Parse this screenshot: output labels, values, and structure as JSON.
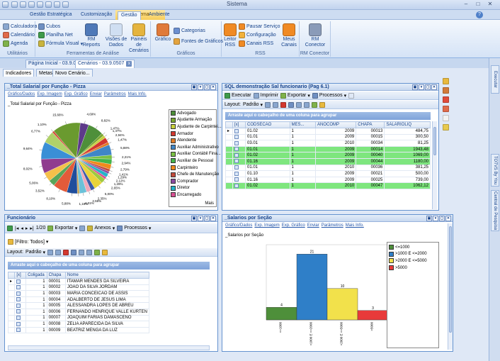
{
  "window": {
    "title": "Sistema"
  },
  "menu": {
    "tabs": [
      "Gestão Estratégica",
      "Customização",
      "Gestão",
      "Ambiente"
    ],
    "active": "Gestão"
  },
  "ribbon": {
    "utilitarios": {
      "label": "Utilitários",
      "items": [
        "Calculadora",
        "Calendário",
        "Agenda"
      ]
    },
    "ferramentas": {
      "label": "Ferramentas de Análise",
      "items": [
        "Cubos",
        "Planilha Net",
        "Fórmula Visual"
      ],
      "big": [
        "RM Reports",
        "Visões de Dados",
        "Painéis de Cenários"
      ]
    },
    "graficos": {
      "label": "Gráficos",
      "big": "Gráfico",
      "items": [
        "Categorias",
        "Fontes de Gráficos"
      ]
    },
    "rss": {
      "label": "RSS",
      "big1": "Leitor RSS",
      "items": [
        "Pausar Serviço",
        "Configuração",
        "Canais RSS"
      ],
      "big2": "Meus Canais"
    },
    "rmconector": {
      "label": "RM Conector",
      "big": "RM Conector"
    }
  },
  "doc_tabs": [
    "Página Inicial - 03.9.0507",
    "Cenários - 03.9.0507"
  ],
  "sub_tabs": [
    "Indicadores",
    "Metas",
    "Novo Cenário..."
  ],
  "right_tabs": [
    "Executar",
    "TOTVS By You",
    "Central de Pesquisa"
  ],
  "pie_panel": {
    "title": "_Total Salarial por Função - Pizza",
    "links": [
      "Gráfico/Dados",
      "Exp. Imagem",
      "Exp. Gráfico",
      "Enviar",
      "Parâmetros",
      "Mais Info."
    ],
    "chart_title": "_Total Salarial por Função - Pizza",
    "legend": [
      "Advogado",
      "Ajudante Armação",
      "Ajudante de Carpintei...",
      "Armador",
      "Atendente",
      "Auxiliar Administrativo",
      "Auxiliar Contábil Fina...",
      "Auxiliar de Pessoal",
      "Carpinteiro",
      "Chefe de Manutenção",
      "Comprador",
      "Diretor",
      "Encarregado"
    ],
    "legend_more": "Mais"
  },
  "sql_panel": {
    "title": "SQL demonstração Sal funcionario (Pag 6.1)",
    "toolbar": [
      "Executar",
      "Imprimir",
      "Exportar",
      "Processos"
    ],
    "layout_label": "Layout:",
    "layout_value": "Padrão",
    "group_hint": "Arraste aqui o cabeçalho de uma coluna para agrupar",
    "columns": [
      "[x]",
      "CODSECAO",
      "MES...",
      "ANOCOMP",
      "CHAPA",
      "SALARIOLIQ"
    ],
    "rows": [
      {
        "codsecao": "01.02",
        "mes": "1",
        "ano": "2009",
        "chapa": "00013",
        "sal": "484,75",
        "hl": false
      },
      {
        "codsecao": "01.01",
        "mes": "1",
        "ano": "2009",
        "chapa": "00015",
        "sal": "300,50",
        "hl": false
      },
      {
        "codsecao": "03.01",
        "mes": "1",
        "ano": "2010",
        "chapa": "00034",
        "sal": "81,25",
        "hl": false
      },
      {
        "codsecao": "01.01",
        "mes": "1",
        "ano": "2009",
        "chapa": "00014",
        "sal": "1943,48",
        "hl": true
      },
      {
        "codsecao": "01.02",
        "mes": "1",
        "ano": "2009",
        "chapa": "00040",
        "sal": "1069,00",
        "hl": true
      },
      {
        "codsecao": "01.16",
        "mes": "1",
        "ano": "2009",
        "chapa": "00044",
        "sal": "1180,00",
        "hl": true
      },
      {
        "codsecao": "01.01",
        "mes": "1",
        "ano": "2010",
        "chapa": "00036",
        "sal": "381,25",
        "hl": false
      },
      {
        "codsecao": "01.10",
        "mes": "1",
        "ano": "2009",
        "chapa": "00021",
        "sal": "500,00",
        "hl": false
      },
      {
        "codsecao": "01.16",
        "mes": "1",
        "ano": "2009",
        "chapa": "00025",
        "sal": "739,00",
        "hl": false
      },
      {
        "codsecao": "01.02",
        "mes": "1",
        "ano": "2010",
        "chapa": "00047",
        "sal": "1062,12",
        "hl": true
      }
    ]
  },
  "func_panel": {
    "title": "Funcionário",
    "pager": "1/20",
    "toolbar": [
      "Exportar",
      "Anexos",
      "Processos"
    ],
    "filter": "[Filtro: Todos]",
    "layout_label": "Layout:",
    "layout_value": "Padrão",
    "group_hint": "Arraste aqui o cabeçalho de uma coluna para agrupar",
    "columns": [
      "[x]",
      "Coligada",
      "Chapa",
      "Nome"
    ],
    "rows": [
      {
        "col": "1",
        "chapa": "00001",
        "nome": "ITAMAR MENDES DA SILVEIRA"
      },
      {
        "col": "1",
        "chapa": "00002",
        "nome": "JOAO DA SILVA JORDAM"
      },
      {
        "col": "1",
        "chapa": "00003",
        "nome": "MARIA CONCEICAO DE ASSIS"
      },
      {
        "col": "1",
        "chapa": "00004",
        "nome": "ADALBERTO DE JESUS LIMA"
      },
      {
        "col": "1",
        "chapa": "00005",
        "nome": "ALESSANDRA LOPES DE ABREU"
      },
      {
        "col": "1",
        "chapa": "00006",
        "nome": "FERNANDO HENRIQUE VALLE KURTEN"
      },
      {
        "col": "1",
        "chapa": "00007",
        "nome": "JOAQUIM FARIAS DAMASCENO"
      },
      {
        "col": "1",
        "chapa": "00008",
        "nome": "ZELIA APARECIDA DA SILVA"
      },
      {
        "col": "1",
        "chapa": "00009",
        "nome": "BEATRIZ MENGA DA LUZ"
      }
    ]
  },
  "bar_panel": {
    "title": "_Salarios por Seção",
    "links": [
      "Gráfico/Dados",
      "Exp. Imagem",
      "Exp. Gráfico",
      "Enviar",
      "Parâmetros",
      "Mais Info."
    ],
    "chart_title": "_Salarios por Seção"
  },
  "chart_data": [
    {
      "type": "pie",
      "title": "_Total Salarial por Função - Pizza",
      "slice_labels": [
        "8,82%",
        "1,47%",
        "1,47%",
        "2,94%",
        "1,47%",
        "5,88%",
        "2,21%",
        "2,94%",
        "2,79%",
        "1,41%",
        "1,29%",
        "2,12%",
        "1,29%",
        "2,65%",
        "5,00%",
        "2,35%",
        "2,59%",
        "4,01%",
        "1,18%",
        "5,88%",
        "8,10%",
        "3,52%",
        "5,06%",
        "8,02%",
        "9,64%",
        "6,77%",
        "1,10%",
        "15,66%",
        "4,69%"
      ],
      "colors": [
        "#4e8f3a",
        "#7aa832",
        "#c9d13c",
        "#d3382f",
        "#e07a25",
        "#3f86c7",
        "#7ac043",
        "#43b54a",
        "#f08a1c",
        "#c24b3a",
        "#8b4aa0",
        "#23b4c9",
        "#d94f92",
        "#a0c93f",
        "#e9d33a",
        "#3d5ba8",
        "#f0a8b8",
        "#6bc1d8",
        "#c7a04c",
        "#1f4e9c",
        "#e35b3a",
        "#59a65a",
        "#f5c04a",
        "#903c8f",
        "#3a8fd6",
        "#b0d16a",
        "#d64f3f",
        "#6a9a2f",
        "#5d3a8a"
      ],
      "values": [
        8.82,
        1.47,
        1.47,
        2.94,
        1.47,
        5.88,
        2.21,
        2.94,
        2.79,
        1.41,
        1.29,
        2.12,
        1.29,
        2.65,
        5.0,
        2.35,
        2.59,
        4.01,
        1.18,
        5.88,
        8.1,
        3.52,
        5.06,
        8.02,
        9.64,
        6.77,
        1.1,
        15.66,
        4.69
      ]
    },
    {
      "type": "bar",
      "title": "_Salarios por Seção",
      "categories": [
        "<=1000",
        ">1000 E <=2000",
        ">2000 E <=5000",
        ">5000"
      ],
      "values": [
        4,
        21,
        10,
        3
      ],
      "colors": [
        "#4e8f3a",
        "#2f7fc8",
        "#f2e14b",
        "#e83a3a"
      ],
      "ylim": [
        0,
        24
      ],
      "legend": [
        "<=1000",
        ">1000 E <=2000",
        ">2000 E <=5000",
        ">5000"
      ]
    }
  ]
}
